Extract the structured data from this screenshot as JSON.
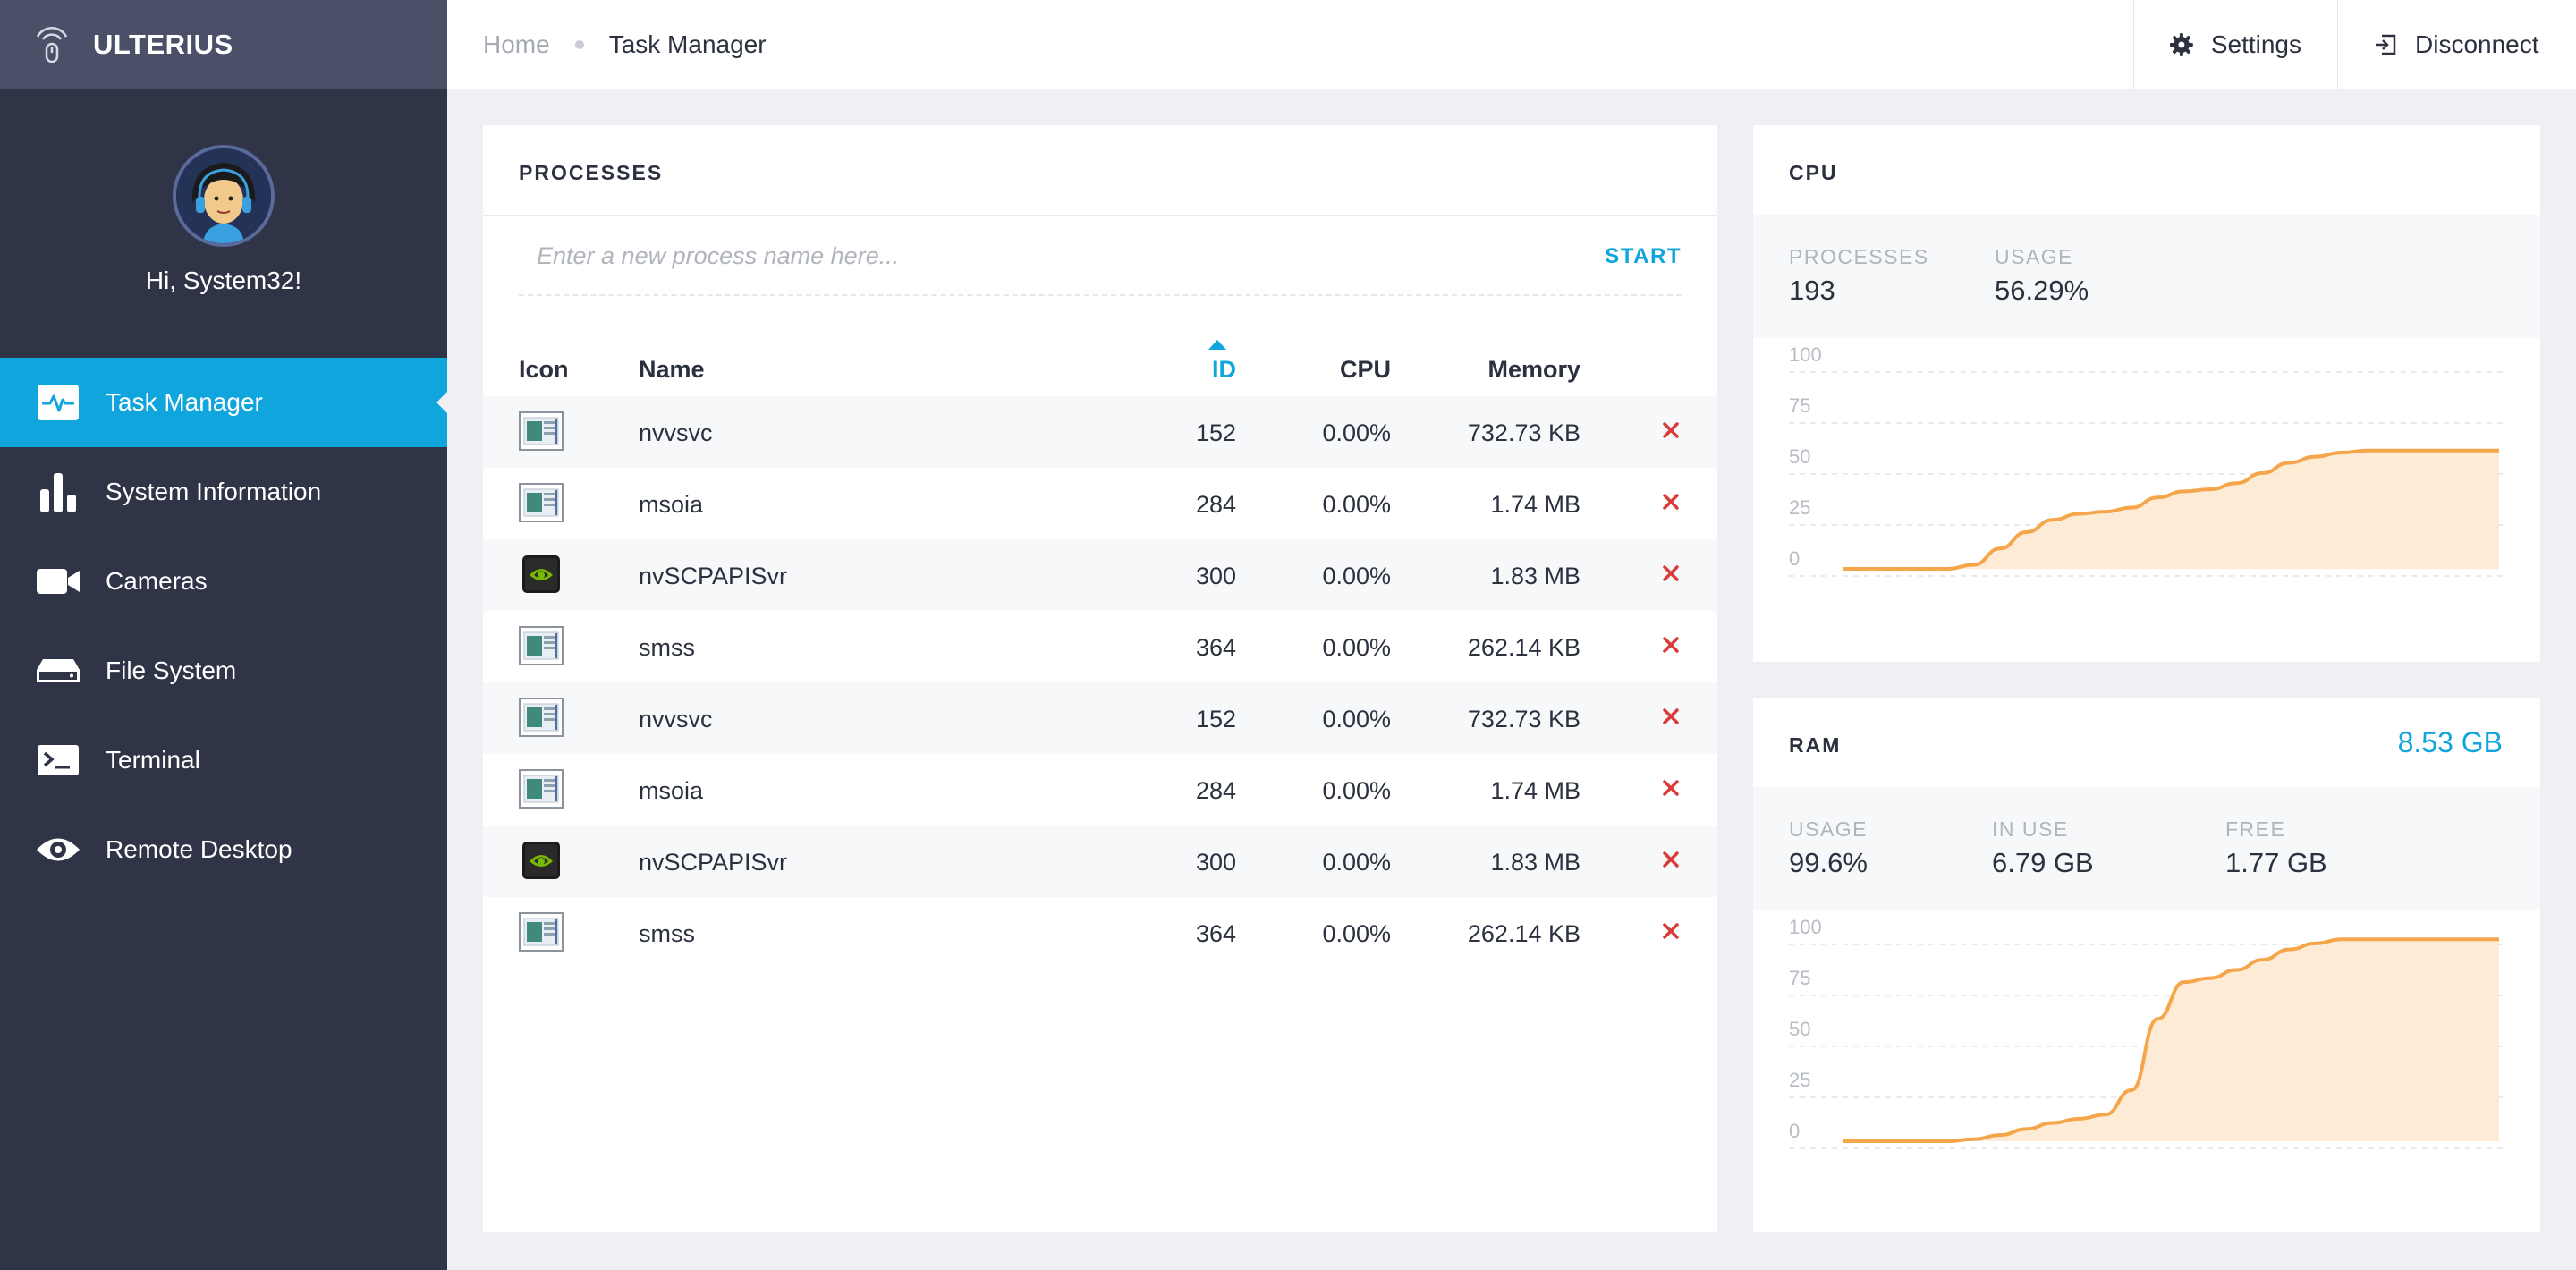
{
  "app": {
    "name": "ULTERIUS"
  },
  "user": {
    "greeting": "Hi, System32!"
  },
  "nav": [
    {
      "label": "Task Manager",
      "icon": "pulse-icon",
      "active": true
    },
    {
      "label": "System Information",
      "icon": "bar-chart-icon"
    },
    {
      "label": "Cameras",
      "icon": "video-camera-icon"
    },
    {
      "label": "File System",
      "icon": "hard-drive-icon"
    },
    {
      "label": "Terminal",
      "icon": "terminal-icon"
    },
    {
      "label": "Remote Desktop",
      "icon": "eye-icon"
    }
  ],
  "breadcrumb": {
    "home": "Home",
    "current": "Task Manager"
  },
  "topbar": {
    "settings": "Settings",
    "disconnect": "Disconnect"
  },
  "processes": {
    "title": "PROCESSES",
    "placeholder": "Enter a new process name here...",
    "start": "START",
    "columns": {
      "icon": "Icon",
      "name": "Name",
      "id": "ID",
      "cpu": "CPU",
      "memory": "Memory"
    },
    "sorted_by": "ID",
    "rows": [
      {
        "icon": "window-app-icon",
        "name": "nvvsvc",
        "id": "152",
        "cpu": "0.00%",
        "memory": "732.73 KB"
      },
      {
        "icon": "window-app-icon",
        "name": "msoia",
        "id": "284",
        "cpu": "0.00%",
        "memory": "1.74 MB"
      },
      {
        "icon": "nvidia-icon",
        "name": "nvSCPAPISvr",
        "id": "300",
        "cpu": "0.00%",
        "memory": "1.83 MB"
      },
      {
        "icon": "window-app-icon",
        "name": "smss",
        "id": "364",
        "cpu": "0.00%",
        "memory": "262.14 KB"
      },
      {
        "icon": "window-app-icon",
        "name": "nvvsvc",
        "id": "152",
        "cpu": "0.00%",
        "memory": "732.73 KB"
      },
      {
        "icon": "window-app-icon",
        "name": "msoia",
        "id": "284",
        "cpu": "0.00%",
        "memory": "1.74 MB"
      },
      {
        "icon": "nvidia-icon",
        "name": "nvSCPAPISvr",
        "id": "300",
        "cpu": "0.00%",
        "memory": "1.83 MB"
      },
      {
        "icon": "window-app-icon",
        "name": "smss",
        "id": "364",
        "cpu": "0.00%",
        "memory": "262.14 KB"
      }
    ]
  },
  "cpu": {
    "title": "CPU",
    "processes_label": "PROCESSES",
    "processes_value": "193",
    "usage_label": "USAGE",
    "usage_value": "56.29%"
  },
  "ram": {
    "title": "RAM",
    "total": "8.53 GB",
    "usage_label": "USAGE",
    "usage_value": "99.6%",
    "inuse_label": "IN USE",
    "inuse_value": "6.79 GB",
    "free_label": "FREE",
    "free_value": "1.77 GB"
  },
  "chart_data": [
    {
      "type": "area",
      "name": "cpu",
      "yticks": [
        100,
        75,
        50,
        25,
        0
      ],
      "ylim": [
        0,
        100
      ],
      "color": "#f5a54a",
      "fill": "#fde8cf",
      "values": [
        0,
        0,
        0,
        0,
        0,
        2,
        10,
        18,
        24,
        27,
        28,
        30,
        35,
        38,
        39,
        42,
        47,
        52,
        55,
        57,
        58,
        58,
        58,
        58,
        58,
        58
      ]
    },
    {
      "type": "area",
      "name": "ram",
      "yticks": [
        100,
        75,
        50,
        25,
        0
      ],
      "ylim": [
        0,
        100
      ],
      "color": "#f5a54a",
      "fill": "#fde8cf",
      "values": [
        0,
        0,
        0,
        0,
        0,
        1,
        3,
        6,
        9,
        11,
        13,
        25,
        60,
        78,
        80,
        84,
        89,
        94,
        97,
        99,
        99,
        99,
        99,
        99,
        99,
        99
      ]
    }
  ],
  "colors": {
    "accent": "#10a5dc",
    "sidebar": "#2f3447",
    "brand_bar": "#4a5068",
    "danger": "#d93b3b",
    "chart_line": "#f5a54a"
  }
}
